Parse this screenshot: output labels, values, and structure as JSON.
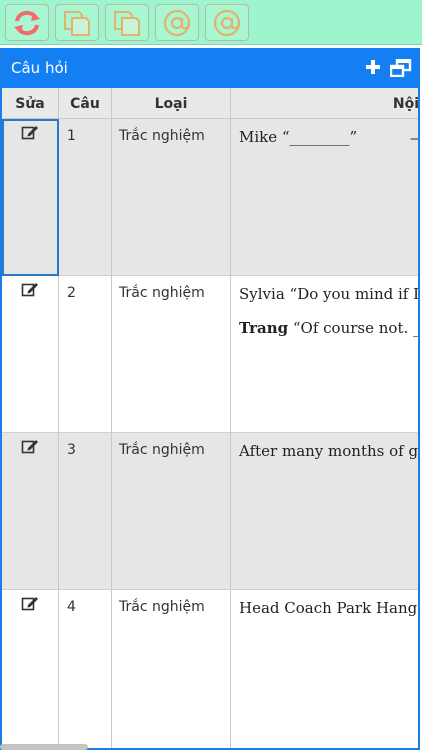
{
  "toolbar": {
    "buttons": [
      {
        "name": "refresh-button",
        "icon": "refresh-icon",
        "color": "#f46b6b"
      },
      {
        "name": "copy-button-1",
        "icon": "copy-icon",
        "color": "#e3b36b"
      },
      {
        "name": "copy-button-2",
        "icon": "copy-icon",
        "color": "#e3b36b"
      },
      {
        "name": "email-button-1",
        "icon": "at-icon",
        "color": "#e3b36b"
      },
      {
        "name": "email-button-2",
        "icon": "at-icon",
        "color": "#e3b36b"
      }
    ],
    "background": "#9cf5cc"
  },
  "panel": {
    "title": "Câu hỏi",
    "header_color": "#137ff3",
    "add_icon": "plus-icon",
    "window_icon": "restore-window-icon"
  },
  "table": {
    "columns": [
      "Sửa",
      "Câu",
      "Loại",
      "Nội"
    ],
    "rows": [
      {
        "number": "1",
        "type": "Trắc nghiệm",
        "lines": [
          "Mike “________”"
        ],
        "line2": ""
      },
      {
        "number": "2",
        "type": "Trắc nghiệm",
        "lines": [
          "Sylvia “Do you mind if I"
        ],
        "line2_bold": "Trang",
        "line2": " “Of course not. __"
      },
      {
        "number": "3",
        "type": "Trắc nghiệm",
        "lines": [
          "After many months of gru"
        ],
        "line2": ""
      },
      {
        "number": "4",
        "type": "Trắc nghiệm",
        "lines": [
          "Head Coach Park Hang–S"
        ],
        "line2": ""
      }
    ]
  }
}
